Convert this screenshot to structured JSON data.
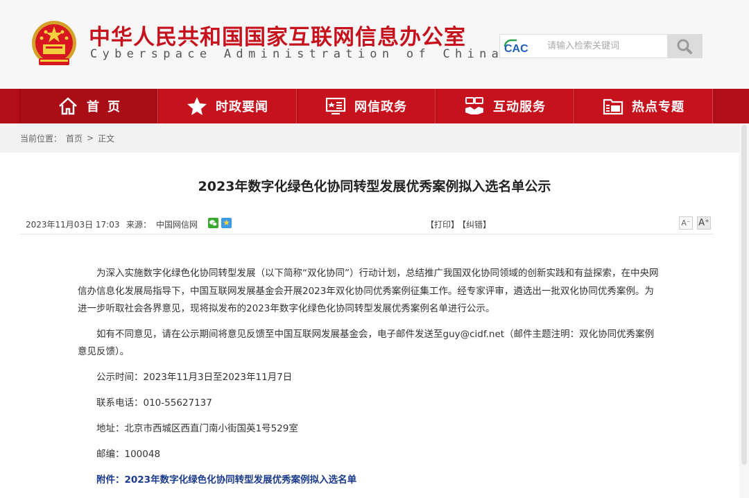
{
  "header": {
    "title_cn": "中华人民共和国国家互联网信息办公室",
    "title_en": "Cyberspace Administration of China",
    "search_logo": "CAC",
    "search_placeholder": "请输入检索关键词",
    "search_icon": "search-icon"
  },
  "nav": {
    "items": [
      {
        "label": "首页",
        "icon": "home-icon"
      },
      {
        "label": "时政要闻",
        "icon": "star-icon"
      },
      {
        "label": "网信政务",
        "icon": "monitor-icon"
      },
      {
        "label": "互动服务",
        "icon": "handshake-icon"
      },
      {
        "label": "热点专题",
        "icon": "folder-icon"
      }
    ],
    "colors": {
      "primary": "#c5121c",
      "active": "#a90d16"
    }
  },
  "breadcrumb": {
    "prefix": "当前位置：",
    "home": "首页",
    "separator": ">",
    "current": "正文"
  },
  "article": {
    "title": "2023年数字化绿色化协同转型发展优秀案例拟入选名单公示",
    "date": "2023年11月03日 17:03",
    "source_label": "来源：",
    "source": "中国网信网",
    "print_label": "【打印】",
    "correct_label": "【纠错】",
    "font_small": "A⁻",
    "font_large": "A⁺",
    "paragraphs": [
      "为深入实施数字化绿色化协同转型发展（以下简称“双化协同”）行动计划，总结推广我国双化协同领域的创新实践和有益探索，在中央网信办信息化发展局指导下，中国互联网发展基金会开展2023年双化协同优秀案例征集工作。经专家评审，遴选出一批双化协同优秀案例。为进一步听取社会各界意见，现将拟发布的2023年数字化绿色化协同转型发展优秀案例名单进行公示。",
      "如有不同意见，请在公示期间将意见反馈至中国互联网发展基金会，电子邮件发送至guy@cidf.net（邮件主题注明：双化协同优秀案例意见反馈）。"
    ],
    "period": "公示时间：2023年11月3日至2023年11月7日",
    "phone": "联系电话：010-55627137",
    "address": "地址：北京市西城区西直门南小街国英1号529室",
    "postcode": "邮编：100048",
    "attachment": "附件：2023年数字化绿色化协同转型发展优秀案例拟入选名单"
  }
}
